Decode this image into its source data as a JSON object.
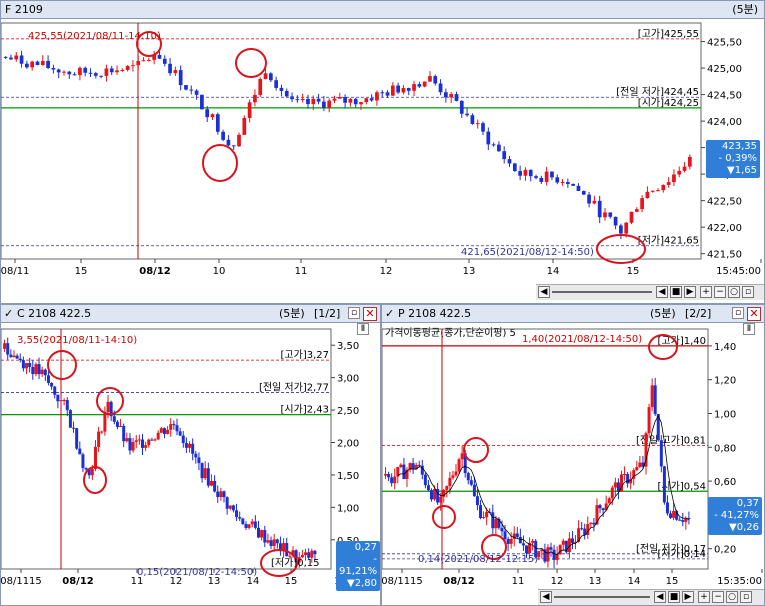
{
  "main": {
    "title": "F 2109",
    "interval": "(5분)",
    "y_ticks": [
      "425,50",
      "425,00",
      "424,50",
      "424,00",
      "423,50",
      "423,00",
      "422,50",
      "422,00",
      "421,50"
    ],
    "x_ticks": [
      "08/11",
      "15",
      "08/12",
      "10",
      "11",
      "12",
      "13",
      "14",
      "15",
      "15:45:00"
    ],
    "high_note": "425,55(2021/08/11-14:10)",
    "low_note": "421,65(2021/08/12-14:50)",
    "levels": [
      {
        "text": "[고가]425,55",
        "value": 425.55,
        "color": "#cc0000",
        "style": "dash"
      },
      {
        "text": "[전일 저가]424,45",
        "value": 424.45,
        "color": "#333399",
        "style": "dash"
      },
      {
        "text": "[시가]424,25",
        "value": 424.25,
        "color": "#009900",
        "style": "solid"
      },
      {
        "text": "[저가]421,65",
        "value": 421.65,
        "color": "#333399",
        "style": "dash"
      }
    ],
    "badge": [
      "423,35",
      "- 0,39%",
      "▼1,65"
    ],
    "ymin": 421.4,
    "ymax": 425.85
  },
  "left": {
    "title": "C 2108 422.5",
    "interval": "(5분)",
    "page": "[1/2]",
    "y_ticks": [
      "3,50",
      "3,00",
      "2,50",
      "2,00",
      "1,50",
      "1,00",
      "0,50"
    ],
    "x_ticks": [
      "08/1115",
      "08/12",
      "11",
      "12",
      "13",
      "14",
      "15",
      "15:35:00"
    ],
    "high_note": "3,55(2021/08/11-14:10)",
    "low_note": "0,15(2021/08/12-14:50)",
    "levels": [
      {
        "text": "[고가]3,27",
        "value": 3.27,
        "color": "#cc0000",
        "style": "dash"
      },
      {
        "text": "[전일 저가]2,77",
        "value": 2.77,
        "color": "#333399",
        "style": "dash"
      },
      {
        "text": "[시가]2,43",
        "value": 2.43,
        "color": "#009900",
        "style": "solid"
      }
    ],
    "low_tag": "[저가]0,15",
    "badge": [
      "0,27",
      "- 91,21%",
      "▼2,80"
    ],
    "ymin": 0.05,
    "ymax": 3.75
  },
  "right": {
    "title": "P 2108 422.5",
    "interval": "(5분)",
    "page": "[2/2]",
    "ma_legend": "가격이동평균(종가,단순이평) 5",
    "y_ticks": [
      "1,40",
      "1,20",
      "1,00",
      "0,80",
      "0,60",
      "0,40",
      "0,20"
    ],
    "x_ticks": [
      "08/1115",
      "08/12",
      "11",
      "12",
      "13",
      "14",
      "15",
      "15:35:00"
    ],
    "high_note": "1,40(2021/08/12-14:50)",
    "low_note": "0,14(2021/08/12-12:15)",
    "levels": [
      {
        "text": "[고가]1,40",
        "value": 1.4,
        "color": "#cc0000",
        "style": "solid"
      },
      {
        "text": "[전일 고가]0,81",
        "value": 0.81,
        "color": "#cc0000",
        "style": "dash"
      },
      {
        "text": "[시가]0,54",
        "value": 0.54,
        "color": "#009900",
        "style": "solid"
      },
      {
        "text": "[전일 저가]0,17",
        "value": 0.17,
        "color": "#333399",
        "style": "dash"
      },
      {
        "text": "[저가]0,14",
        "value": 0.14,
        "color": "#333399",
        "style": "dash"
      }
    ],
    "badge": [
      "0,37",
      "- 41,27%",
      "▼0,26"
    ],
    "ymin": 0.08,
    "ymax": 1.5
  },
  "colors": {
    "up": "#e8141c",
    "down": "#1a2fd6",
    "titlebar": "#dfe6f3",
    "badge": "#2f7fd8"
  }
}
